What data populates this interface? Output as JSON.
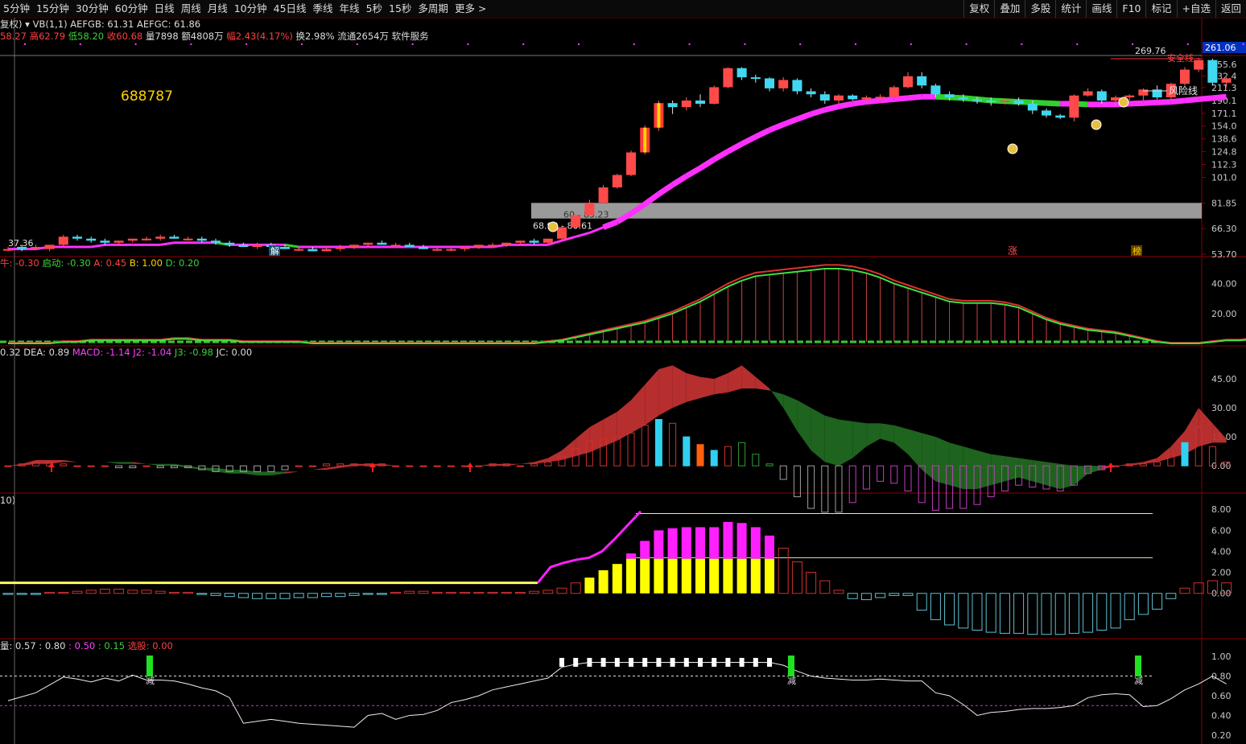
{
  "toolbar": {
    "periods": [
      "5分钟",
      "15分钟",
      "30分钟",
      "60分钟",
      "日线",
      "周线",
      "月线",
      "10分钟",
      "45日线",
      "季线",
      "年线",
      "5秒",
      "15秒",
      "多周期",
      "更多 >"
    ],
    "right": [
      "复权",
      "叠加",
      "多股",
      "统计",
      "画线",
      "F10",
      "标记",
      "+自选",
      "返回"
    ]
  },
  "info": {
    "fuquan": "复权)",
    "vb": "VB(1,1)",
    "aefgb": "AEFGB: 61.31",
    "aefgc": "AEFGC: 61.86",
    "open": "58.27",
    "high": "高62.79",
    "low": "低58.20",
    "close": "收60.68",
    "vol": "量7898",
    "amt": "额4808万",
    "chg": "幅2.43(4.17%)",
    "turn": "换2.98%",
    "float": "流通2654万",
    "industry": "软件服务"
  },
  "main": {
    "code": "688787",
    "price_cursor": "261.06",
    "high_label": "269.76",
    "safe_line": "安全线",
    "risk_line": "风险线",
    "low_label": "37.36",
    "range1": "60 - 85.23",
    "range2": "68.98 - 80.61",
    "markers": {
      "jie": "解",
      "zhang": "涨",
      "bang": "榜"
    },
    "yticks": [
      "255.6",
      "232.4",
      "211.3",
      "190.1",
      "171.1",
      "154.0",
      "138.6",
      "124.8",
      "112.3",
      "101.0",
      "81.85",
      "66.30",
      "53.70"
    ]
  },
  "pane2": {
    "label_a": "牛: -0.30",
    "label_b": "启动: -0.30",
    "label_c": "A: 0.45",
    "label_d": "B: 1.00",
    "label_e": "D: 0.20",
    "yticks": [
      "40.00",
      "20.00"
    ]
  },
  "pane3": {
    "label_a": "0.32",
    "label_b": "DEA: 0.89",
    "label_c": "MACD: -1.14",
    "label_d": "J2: -1.04",
    "label_e": "J3: -0.98",
    "label_f": "JC: 0.00",
    "yticks": [
      "45.00",
      "30.00",
      "15.00",
      "0.00"
    ]
  },
  "pane4": {
    "label_a": "10)",
    "yticks": [
      "8.00",
      "6.00",
      "4.00",
      "2.00",
      "0.00"
    ]
  },
  "pane5": {
    "label_a": "量: 0.57",
    "label_b": ": 0.80",
    "label_c": ": 0.50",
    "label_d": ": 0.15",
    "label_e": "选股: 0.00",
    "marker": "减",
    "yticks": [
      "1.00",
      "0.80",
      "0.60",
      "0.40",
      "0.20"
    ]
  },
  "colors": {
    "up": "#ff4a4a",
    "down": "#40d8f0",
    "ma_pos": "#ff30ff",
    "ma_neg": "#30d030",
    "grid": "#8b0000",
    "yellow": "#ffff00"
  },
  "chart_data": [
    {
      "type": "candlestick",
      "title": "688787",
      "yscale": "log",
      "ylim": [
        53.7,
        269.76
      ],
      "yticks": [
        255.6,
        232.4,
        211.3,
        190.1,
        171.1,
        154.0,
        138.6,
        124.8,
        112.3,
        101.0,
        81.85,
        66.3,
        53.7
      ],
      "candles": [
        [
          56,
          57,
          55,
          56
        ],
        [
          57,
          58,
          55,
          56
        ],
        [
          57,
          58,
          56,
          57
        ],
        [
          56,
          58,
          55,
          58
        ],
        [
          58,
          63,
          57,
          62
        ],
        [
          62,
          63,
          60,
          61
        ],
        [
          61,
          62,
          59,
          60
        ],
        [
          60,
          61,
          58,
          59
        ],
        [
          59,
          60,
          58,
          60
        ],
        [
          60,
          61,
          59,
          61
        ],
        [
          61,
          62,
          60,
          61
        ],
        [
          61,
          63,
          60,
          62
        ],
        [
          62,
          63,
          61,
          61
        ],
        [
          61,
          62,
          60,
          61
        ],
        [
          61,
          62,
          59,
          60
        ],
        [
          60,
          61,
          58,
          59
        ],
        [
          59,
          60,
          57,
          58
        ],
        [
          58,
          59,
          57,
          57
        ],
        [
          57,
          59,
          56,
          58
        ],
        [
          58,
          59,
          56,
          57
        ],
        [
          57,
          58,
          56,
          56
        ],
        [
          56,
          57,
          55,
          56
        ],
        [
          56,
          57,
          55,
          55
        ],
        [
          55,
          57,
          55,
          56
        ],
        [
          56,
          58,
          55,
          57
        ],
        [
          57,
          58,
          56,
          58
        ],
        [
          58,
          59,
          57,
          59
        ],
        [
          59,
          60,
          58,
          58
        ],
        [
          58,
          59,
          57,
          58
        ],
        [
          58,
          59,
          57,
          57
        ],
        [
          57,
          58,
          56,
          56
        ],
        [
          56,
          57,
          55,
          56
        ],
        [
          56,
          57,
          55,
          56
        ],
        [
          56,
          57,
          55,
          57
        ],
        [
          57,
          58,
          56,
          58
        ],
        [
          58,
          59,
          57,
          58
        ],
        [
          58,
          59,
          57,
          59
        ],
        [
          59,
          60,
          58,
          60
        ],
        [
          60,
          61,
          58,
          59
        ],
        [
          59,
          61,
          58,
          61
        ],
        [
          61,
          68,
          60,
          67
        ],
        [
          67,
          75,
          66,
          74
        ],
        [
          74,
          84,
          73,
          82
        ],
        [
          82,
          95,
          81,
          93
        ],
        [
          93,
          104,
          92,
          103
        ],
        [
          103,
          126,
          102,
          124
        ],
        [
          124,
          155,
          122,
          152
        ],
        [
          152,
          190,
          148,
          186
        ],
        [
          186,
          190,
          170,
          180
        ],
        [
          180,
          195,
          175,
          190
        ],
        [
          190,
          200,
          180,
          185
        ],
        [
          185,
          215,
          184,
          212
        ],
        [
          212,
          250,
          210,
          248
        ],
        [
          248,
          250,
          225,
          230
        ],
        [
          230,
          235,
          220,
          228
        ],
        [
          228,
          230,
          205,
          210
        ],
        [
          210,
          230,
          205,
          225
        ],
        [
          225,
          228,
          200,
          205
        ],
        [
          205,
          210,
          195,
          200
        ],
        [
          200,
          205,
          185,
          190
        ],
        [
          190,
          200,
          185,
          198
        ],
        [
          198,
          200,
          190,
          192
        ],
        [
          192,
          198,
          188,
          195
        ],
        [
          195,
          200,
          190,
          196
        ],
        [
          196,
          215,
          195,
          212
        ],
        [
          212,
          240,
          210,
          232
        ],
        [
          232,
          240,
          210,
          215
        ],
        [
          215,
          218,
          195,
          200
        ],
        [
          200,
          205,
          190,
          195
        ],
        [
          195,
          200,
          188,
          192
        ],
        [
          192,
          196,
          185,
          190
        ],
        [
          190,
          195,
          182,
          188
        ],
        [
          188,
          193,
          184,
          190
        ],
        [
          190,
          195,
          182,
          185
        ],
        [
          185,
          190,
          170,
          175
        ],
        [
          175,
          178,
          165,
          168
        ],
        [
          168,
          170,
          163,
          165
        ],
        [
          165,
          200,
          160,
          198
        ],
        [
          198,
          210,
          196,
          205
        ],
        [
          205,
          208,
          185,
          190
        ],
        [
          190,
          198,
          182,
          195
        ],
        [
          195,
          200,
          190,
          198
        ],
        [
          198,
          210,
          190,
          208
        ],
        [
          208,
          215,
          192,
          195
        ],
        [
          195,
          220,
          192,
          218
        ],
        [
          218,
          250,
          215,
          245
        ],
        [
          245,
          270,
          240,
          265
        ],
        [
          265,
          268,
          215,
          220
        ],
        [
          220,
          230,
          212,
          228
        ]
      ],
      "ma_line": [
        56,
        56,
        56,
        57,
        57,
        57,
        57,
        58,
        58,
        58,
        58,
        58,
        59,
        59,
        59,
        59,
        58,
        58,
        58,
        58,
        58,
        57,
        57,
        57,
        57,
        57,
        57,
        57,
        57,
        57,
        57,
        57,
        57,
        57,
        57,
        57,
        58,
        58,
        58,
        58,
        60,
        62,
        64,
        67,
        70,
        75,
        81,
        88,
        95,
        102,
        109,
        117,
        125,
        133,
        141,
        149,
        156,
        163,
        170,
        176,
        181,
        185,
        188,
        190,
        192,
        194,
        196,
        196,
        195,
        194,
        192,
        190,
        189,
        188,
        187,
        186,
        185,
        185,
        184,
        184,
        184,
        185,
        186,
        187,
        188,
        190,
        192,
        194,
        196
      ]
    },
    {
      "type": "line",
      "series_labels": [
        "牛: -0.30",
        "启动: -0.30",
        "A: 0.45",
        "B: 1.00",
        "D: 0.20"
      ],
      "ylim": [
        0,
        50
      ],
      "yticks": [
        40,
        20
      ],
      "line": [
        0,
        0,
        0,
        0,
        1,
        1,
        2,
        2,
        2,
        2,
        2,
        2,
        3,
        3,
        2,
        2,
        2,
        1,
        1,
        1,
        1,
        1,
        0,
        0,
        0,
        0,
        0,
        0,
        0,
        0,
        0,
        0,
        0,
        0,
        0,
        0,
        0,
        0,
        0,
        1,
        2,
        4,
        6,
        8,
        10,
        12,
        14,
        17,
        20,
        24,
        28,
        33,
        38,
        42,
        45,
        46,
        47,
        48,
        49,
        50,
        50,
        49,
        47,
        44,
        40,
        37,
        34,
        31,
        28,
        27,
        27,
        27,
        26,
        24,
        20,
        16,
        13,
        11,
        9,
        8,
        7,
        5,
        3,
        1,
        0,
        0,
        0,
        1,
        2,
        2,
        3,
        4,
        5,
        8,
        11,
        15,
        17,
        18,
        18
      ]
    },
    {
      "type": "line",
      "series_labels": [
        "0.32",
        "DEA: 0.89",
        "MACD: -1.14",
        "J2: -1.04",
        "J3: -0.98",
        "JC: 0.00"
      ],
      "ylim": [
        -12,
        55
      ],
      "yticks": [
        45,
        30,
        15,
        0
      ],
      "dif": [
        0,
        1,
        3,
        3,
        3,
        2,
        2,
        2,
        1,
        1,
        1,
        0,
        0,
        -1,
        -2,
        -3,
        -4,
        -4,
        -5,
        -5,
        -4,
        -3,
        -2,
        -1,
        0,
        1,
        1,
        1,
        0,
        0,
        0,
        0,
        0,
        0,
        0,
        1,
        1,
        1,
        2,
        4,
        8,
        14,
        20,
        24,
        28,
        34,
        42,
        50,
        52,
        48,
        46,
        45,
        48,
        52,
        46,
        40,
        30,
        18,
        8,
        2,
        0,
        4,
        10,
        14,
        12,
        6,
        -2,
        -8,
        -10,
        -12,
        -12,
        -10,
        -8,
        -6,
        -8,
        -10,
        -12,
        -10,
        -4,
        -2,
        0,
        1,
        2,
        4,
        10,
        18,
        30,
        22,
        14
      ],
      "dea": [
        0,
        0,
        1,
        1,
        2,
        2,
        2,
        2,
        2,
        2,
        1,
        1,
        1,
        0,
        -1,
        -1,
        -2,
        -2,
        -3,
        -3,
        -3,
        -3,
        -2,
        -2,
        -1,
        0,
        0,
        0,
        0,
        0,
        0,
        0,
        0,
        0,
        0,
        0,
        0,
        1,
        1,
        2,
        3,
        5,
        7,
        10,
        13,
        17,
        21,
        26,
        30,
        33,
        35,
        37,
        38,
        40,
        40,
        39,
        37,
        34,
        30,
        26,
        24,
        23,
        22,
        22,
        21,
        19,
        17,
        15,
        12,
        10,
        8,
        6,
        5,
        4,
        3,
        2,
        1,
        0,
        0,
        0,
        0,
        0,
        1,
        2,
        4,
        6,
        10,
        12,
        12
      ],
      "macd": [
        0,
        1,
        2,
        2,
        1,
        0,
        0,
        0,
        -1,
        -1,
        0,
        -1,
        -1,
        -1,
        -2,
        -3,
        -3,
        -3,
        -3,
        -3,
        -2,
        0,
        0,
        1,
        1,
        1,
        1,
        1,
        0,
        0,
        0,
        0,
        0,
        0,
        0,
        1,
        1,
        0,
        1,
        2,
        5,
        9,
        13,
        14,
        15,
        17,
        21,
        24,
        22,
        15,
        11,
        8,
        10,
        12,
        6,
        1,
        -7,
        -16,
        -22,
        -24,
        -24,
        -19,
        -12,
        -8,
        -9,
        -13,
        -19,
        -23,
        -22,
        -22,
        -20,
        -16,
        -13,
        -10,
        -11,
        -12,
        -13,
        -10,
        -4,
        -2,
        0,
        1,
        1,
        2,
        6,
        12,
        20,
        10,
        2
      ]
    },
    {
      "type": "bar",
      "series_labels": [
        "10)"
      ],
      "ylim": [
        -4,
        8.4
      ],
      "yticks": [
        8,
        6,
        4,
        2,
        0
      ],
      "values": [
        -0.1,
        -0.1,
        -0.1,
        0.1,
        0.1,
        0.2,
        0.3,
        0.4,
        0.4,
        0.3,
        0.3,
        0.2,
        0.1,
        0.1,
        -0.1,
        -0.2,
        -0.3,
        -0.4,
        -0.5,
        -0.5,
        -0.5,
        -0.4,
        -0.4,
        -0.3,
        -0.3,
        -0.2,
        -0.1,
        -0.1,
        0.1,
        0.2,
        0.2,
        0.1,
        0.1,
        0.1,
        0.1,
        0.1,
        0.1,
        0.1,
        0.2,
        0.3,
        0.5,
        1.0,
        1.5,
        2.2,
        2.8,
        3.8,
        5.0,
        6.0,
        6.2,
        6.3,
        6.3,
        6.3,
        6.8,
        6.7,
        6.3,
        5.5,
        4.3,
        3.0,
        2.0,
        1.2,
        0.3,
        -0.5,
        -0.6,
        -0.4,
        -0.2,
        -0.2,
        -1.6,
        -2.5,
        -3.0,
        -3.3,
        -3.5,
        -3.7,
        -3.8,
        -3.8,
        -3.9,
        -3.9,
        -3.9,
        -3.8,
        -3.7,
        -3.5,
        -3.3,
        -2.5,
        -2.0,
        -1.5,
        -0.5,
        0.5,
        1.0,
        1.2,
        1.0
      ],
      "yellow_line": [
        1.0,
        1.0,
        1.0,
        1.0,
        1.0,
        1.0,
        1.0,
        1.0,
        1.0,
        1.0,
        1.0,
        1.0,
        1.0,
        1.0,
        1.0,
        1.0,
        1.0,
        1.0,
        1.0,
        1.0,
        1.0,
        1.0,
        1.0,
        1.0,
        1.0,
        1.0,
        1.0,
        1.0,
        1.0,
        1.0,
        1.0,
        1.0,
        1.0,
        1.0,
        1.0,
        1.0,
        1.0,
        1.0,
        1.0,
        1.0
      ],
      "magenta_line": [
        1.0,
        2.5,
        2.9,
        3.2,
        3.4,
        4.0,
        5.2,
        6.5,
        7.8
      ],
      "ref_lines": [
        7.6,
        3.4
      ]
    },
    {
      "type": "line",
      "series_labels": [
        "量: 0.57",
        ": 0.80",
        ": 0.50",
        ": 0.15",
        "选股: 0.00"
      ],
      "ylim": [
        0.15,
        1.05
      ],
      "yticks": [
        1.0,
        0.8,
        0.6,
        0.4,
        0.2
      ],
      "ref_lines": [
        0.8,
        0.5
      ],
      "line": [
        0.55,
        0.59,
        0.63,
        0.71,
        0.79,
        0.77,
        0.74,
        0.78,
        0.75,
        0.81,
        0.76,
        0.76,
        0.75,
        0.72,
        0.68,
        0.65,
        0.58,
        0.32,
        0.34,
        0.36,
        0.34,
        0.32,
        0.31,
        0.3,
        0.29,
        0.28,
        0.4,
        0.42,
        0.36,
        0.4,
        0.41,
        0.45,
        0.53,
        0.56,
        0.6,
        0.66,
        0.69,
        0.72,
        0.75,
        0.78,
        0.89,
        0.92,
        0.94,
        0.94,
        0.94,
        0.94,
        0.94,
        0.94,
        0.94,
        0.94,
        0.94,
        0.94,
        0.94,
        0.94,
        0.94,
        0.94,
        0.91,
        0.85,
        0.8,
        0.78,
        0.77,
        0.76,
        0.76,
        0.77,
        0.76,
        0.75,
        0.75,
        0.63,
        0.6,
        0.51,
        0.4,
        0.43,
        0.44,
        0.46,
        0.47,
        0.47,
        0.48,
        0.5,
        0.58,
        0.61,
        0.62,
        0.61,
        0.49,
        0.5,
        0.57,
        0.66,
        0.72,
        0.8,
        0.72
      ]
    }
  ]
}
